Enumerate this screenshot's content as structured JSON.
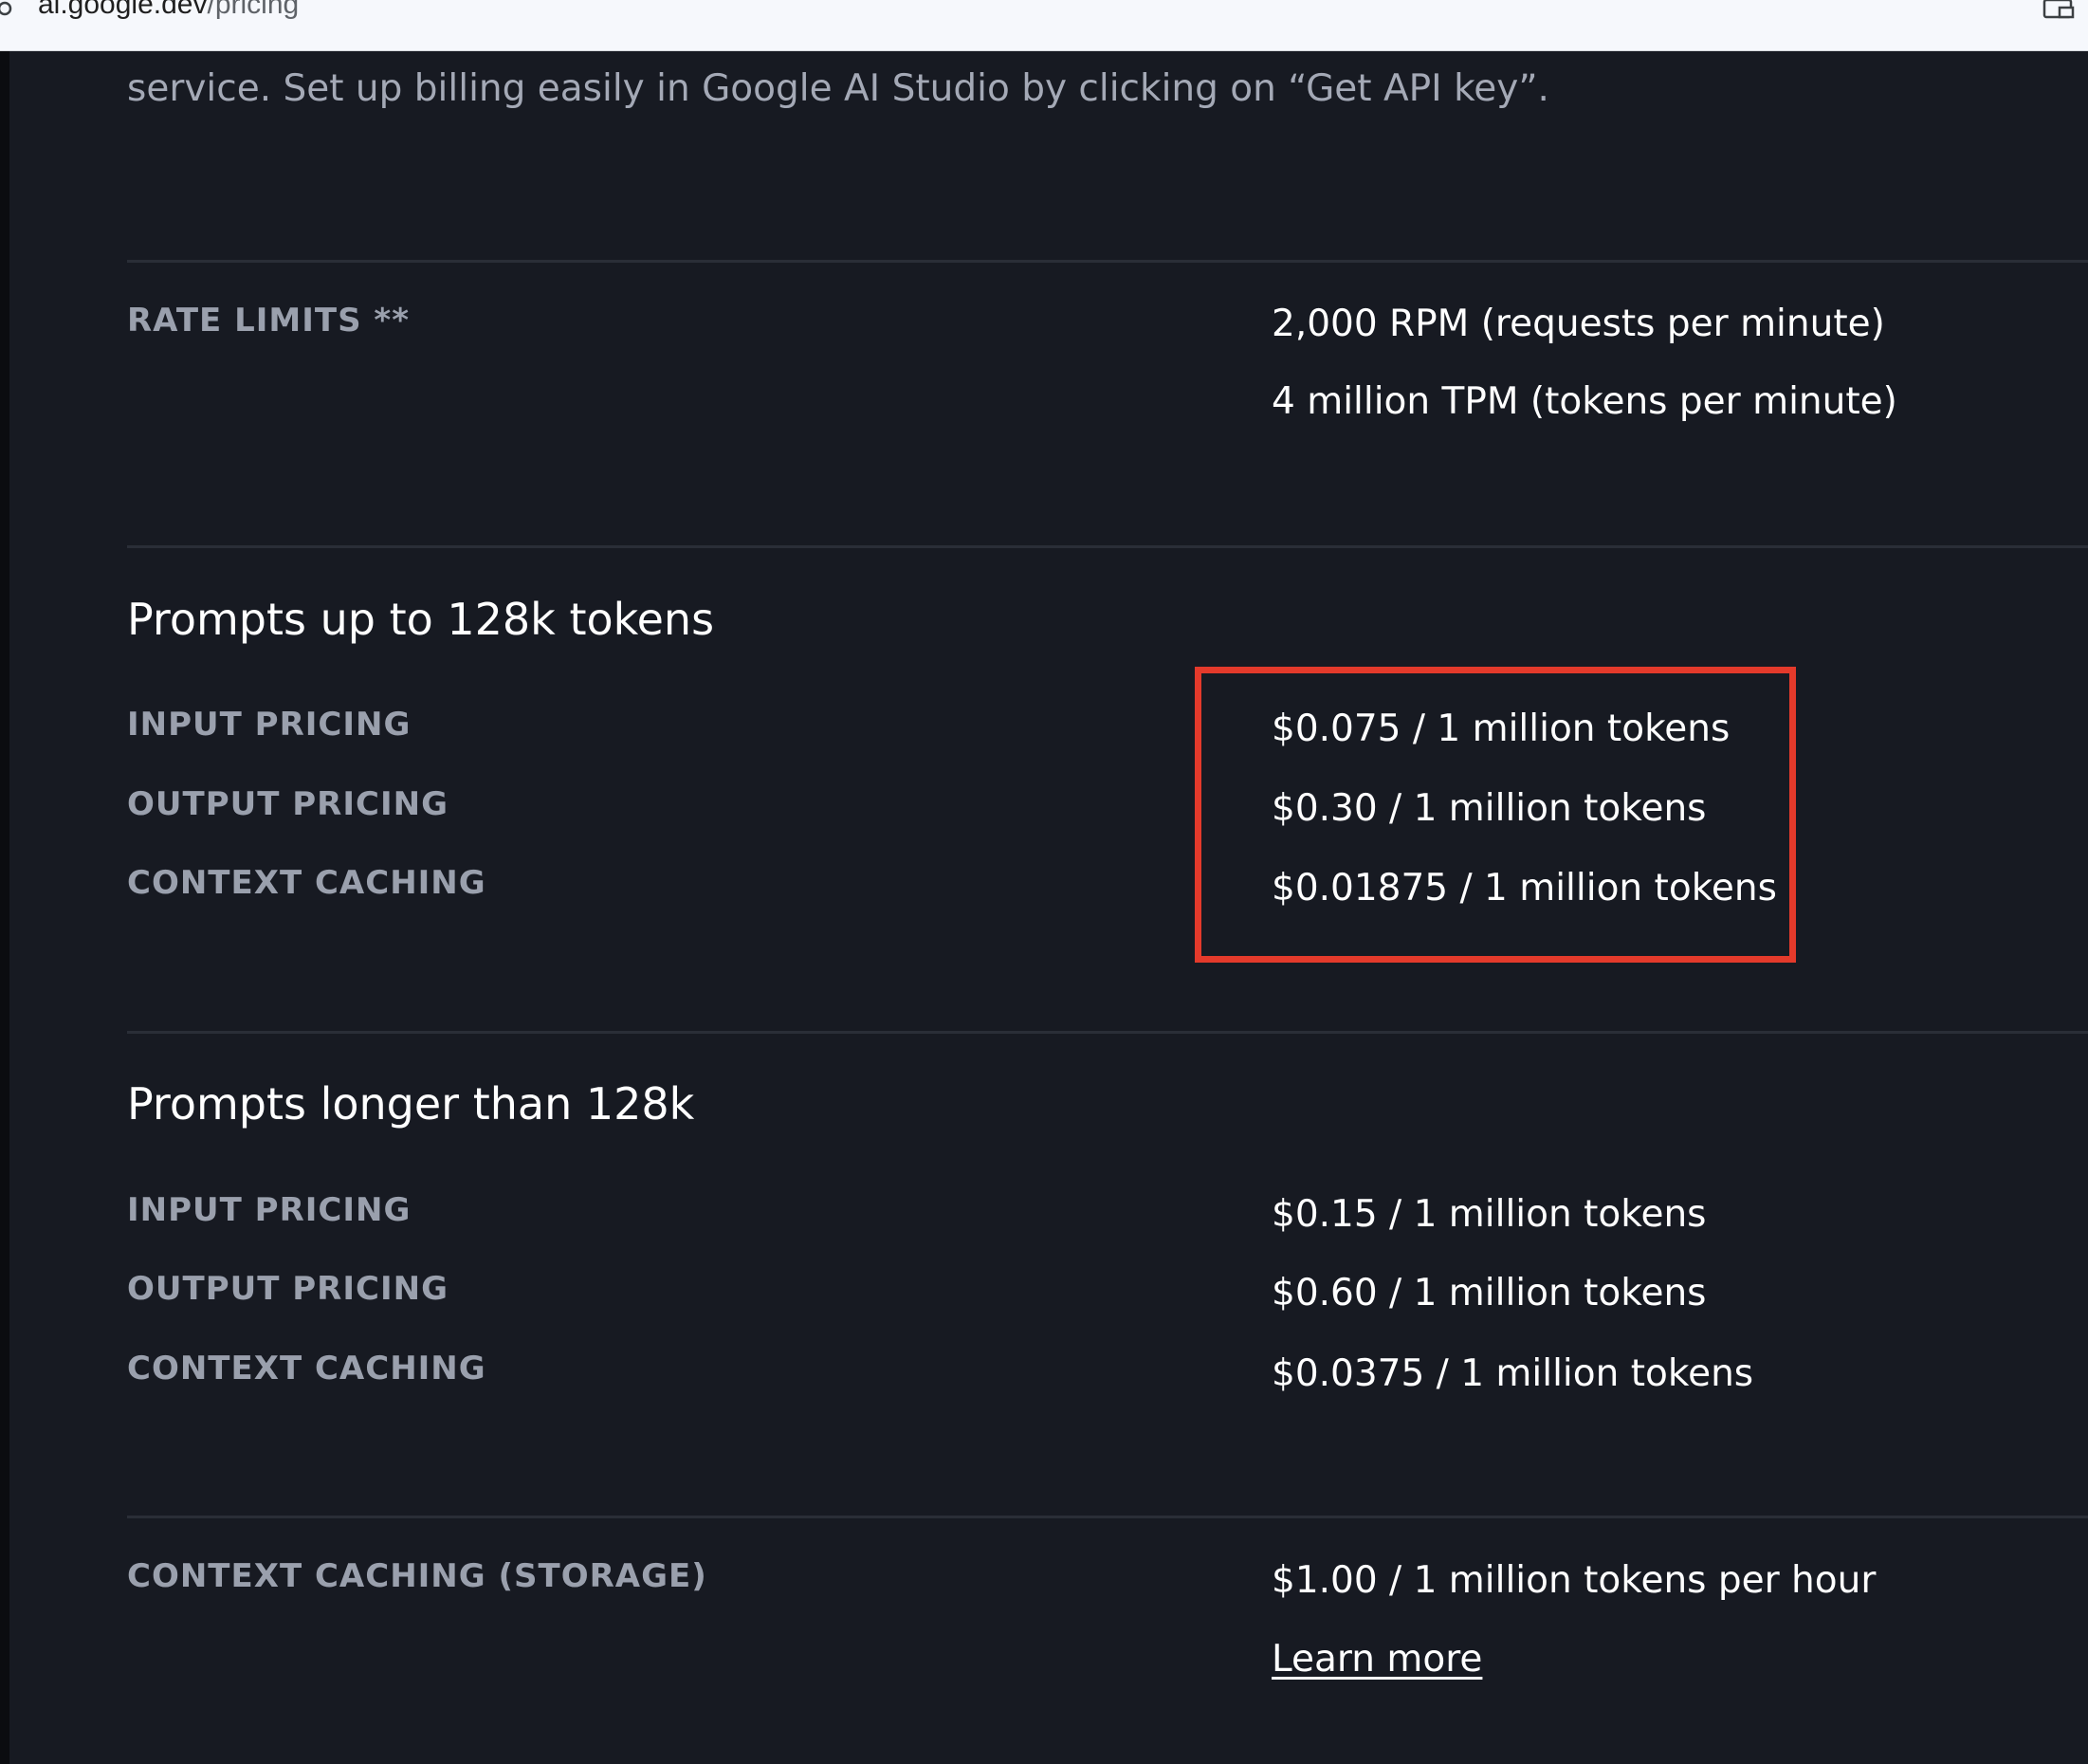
{
  "browser": {
    "url_host": "ai.google.dev",
    "url_path": "/pricing"
  },
  "intro": {
    "text": "service. Set up billing easily in Google AI Studio by clicking on “Get API key”."
  },
  "rate_limits": {
    "label": "RATE LIMITS **",
    "values": [
      "2,000 RPM (requests per minute)",
      "4 million TPM (tokens per minute)"
    ]
  },
  "prompts_short": {
    "title": "Prompts up to 128k tokens",
    "rows": [
      {
        "label": "INPUT PRICING",
        "value": "$0.075 / 1 million tokens"
      },
      {
        "label": "OUTPUT PRICING",
        "value": "$0.30 / 1 million tokens"
      },
      {
        "label": "CONTEXT CACHING",
        "value": "$0.01875 / 1 million tokens"
      }
    ]
  },
  "prompts_long": {
    "title": "Prompts longer than 128k",
    "rows": [
      {
        "label": "INPUT PRICING",
        "value": "$0.15 / 1 million tokens"
      },
      {
        "label": "OUTPUT PRICING",
        "value": "$0.60 / 1 million tokens"
      },
      {
        "label": "CONTEXT CACHING",
        "value": "$0.0375 / 1 million tokens"
      }
    ]
  },
  "storage": {
    "label": "CONTEXT CACHING (STORAGE)",
    "value": "$1.00 / 1 million tokens per hour",
    "link": "Learn more"
  },
  "colors": {
    "background": "#171a22",
    "label": "#9aa0ad",
    "highlight": "#e43a2b"
  },
  "icons": [
    "site-info-icon",
    "screen-cast-icon"
  ]
}
